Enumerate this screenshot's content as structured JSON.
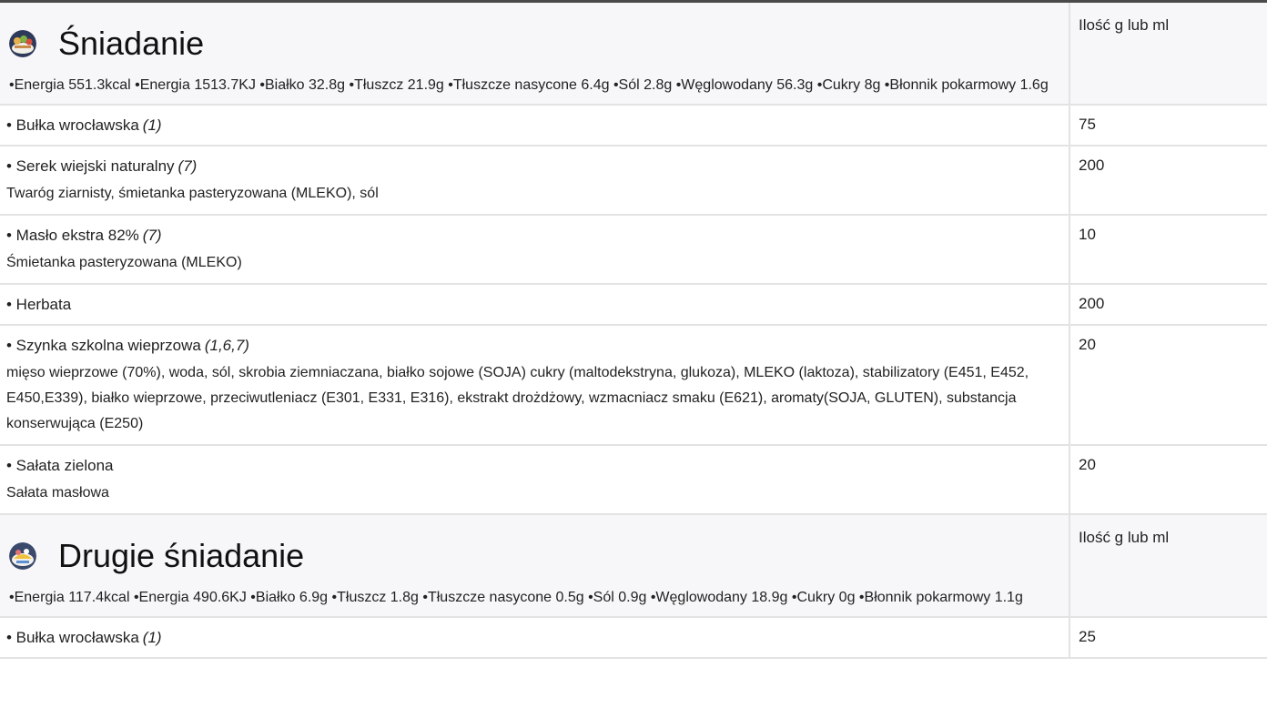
{
  "quantity_header": "Ilość g lub ml",
  "meals": [
    {
      "name": "Śniadanie",
      "icon": "breakfast-plate-icon",
      "nutrition": "•Energia 551.3kcal •Energia 1513.7KJ •Białko 32.8g •Tłuszcz 21.9g •Tłuszcze nasycone 6.4g •Sól 2.8g •Węglowodany 56.3g •Cukry 8g •Błonnik pokarmowy 1.6g",
      "items": [
        {
          "name": "• Bułka wrocławska",
          "allergens": "(1)",
          "ingredients": "",
          "qty": "75"
        },
        {
          "name": "• Serek wiejski naturalny",
          "allergens": "(7)",
          "ingredients": "Twaróg ziarnisty, śmietanka pasteryzowana (MLEKO), sól",
          "qty": "200"
        },
        {
          "name": "• Masło ekstra 82%",
          "allergens": "(7)",
          "ingredients": "Śmietanka pasteryzowana (MLEKO)",
          "qty": "10"
        },
        {
          "name": "• Herbata",
          "allergens": "",
          "ingredients": "",
          "qty": "200"
        },
        {
          "name": "• Szynka szkolna wieprzowa",
          "allergens": "(1,6,7)",
          "ingredients": "mięso wieprzowe (70%), woda, sól, skrobia ziemniaczana, białko sojowe (SOJA) cukry (maltodekstryna, glukoza), MLEKO (laktoza), stabilizatory (E451, E452, E450,E339), białko wieprzowe, przeciwutleniacz (E301, E331, E316), ekstrakt drożdżowy, wzmacniacz smaku (E621), aromaty(SOJA, GLUTEN), substancja konserwująca (E250)",
          "qty": "20"
        },
        {
          "name": "• Sałata zielona",
          "allergens": "",
          "ingredients": "Sałata masłowa",
          "qty": "20"
        }
      ]
    },
    {
      "name": "Drugie śniadanie",
      "icon": "second-breakfast-plate-icon",
      "nutrition": "•Energia 117.4kcal •Energia 490.6KJ •Białko 6.9g •Tłuszcz 1.8g •Tłuszcze nasycone 0.5g •Sól 0.9g •Węglowodany 18.9g •Cukry 0g •Błonnik pokarmowy 1.1g",
      "items": [
        {
          "name": "• Bułka wrocławska",
          "allergens": "(1)",
          "ingredients": "",
          "qty": "25"
        }
      ]
    }
  ]
}
